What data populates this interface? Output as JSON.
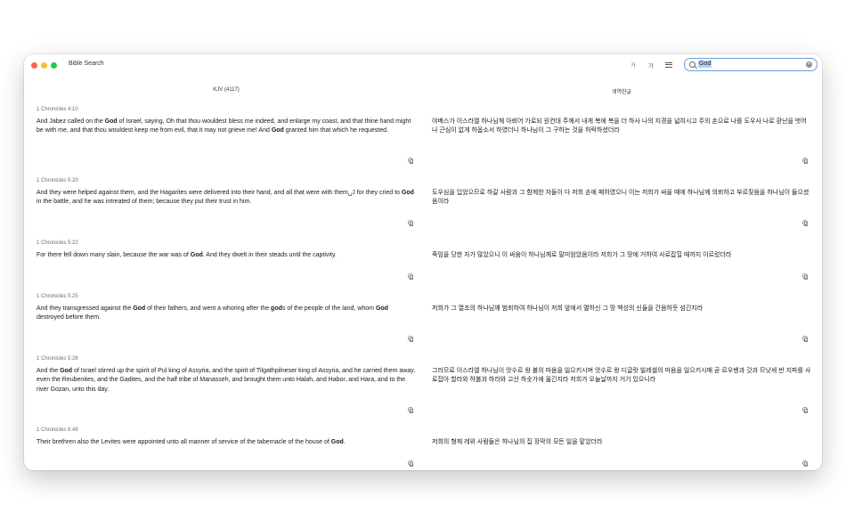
{
  "window": {
    "title": "Bible Search",
    "font_small_label": "가",
    "font_large_label": "가",
    "search": {
      "value": "God",
      "placeholder": ""
    }
  },
  "columns": {
    "left_header": "KJV (4117)",
    "right_header": "개역한글"
  },
  "verses": [
    {
      "ref": "1 Chronicles 4:10",
      "en": [
        "And Jabez called on the ",
        "God",
        " of Israel, saying, Oh that thou wouldest bless me indeed, and enlarge my coast, and that thine hand might be with me, and that thou wouldest keep me from evil, that it may not grieve me! And ",
        "God",
        " granted him that which he requested."
      ],
      "ko": "야베스가 이스라엘 하나님께 아뢰어 가로되 원컨대 주께서 내게 복에 복을 더 하사 나의 지경을 넓히시고 주의 손으로 나를 도우사 나로 환난을 벗어나 근심이 없게 하옵소서 하였더니 하나님이 그 구하는 것을 허락하셨더라"
    },
    {
      "ref": "1 Chronicles 5:20",
      "en": [
        "And they were helped against them, and the Hagarites were delivered into their hand, and all that were with them␣J for they cried to ",
        "God",
        " in the battle, and he was intreated of them; because they put their trust in him."
      ],
      "ko": "도우심을 입었으므로 하갈 사람과 그 함께한 자들이 다 저희 손에 패하였으니 이는 저희가 싸울 때에 하나님께 의뢰하고 부르짖음을 하나님이 들으셨음이라"
    },
    {
      "ref": "1 Chronicles 5:22",
      "en": [
        "For there fell down many slain, because the war was of ",
        "God",
        ". And they dwelt in their steads until the captivity."
      ],
      "ko": "죽임을 당한 자가 많았으니 이 싸움이 하나님께로 말미암았음이라 저희가 그 땅에 거하여 사로잡힐 때까지 이르렀더라"
    },
    {
      "ref": "1 Chronicles 5:25",
      "en": [
        "And they transgressed against the ",
        "God",
        " of their fathers, and went a whoring after the ",
        "god",
        "s of the people of the land, whom ",
        "God",
        " destroyed before them."
      ],
      "ko": "저희가 그 열조의 하나님께 범죄하여 하나님이 저희 앞에서 멸하신 그 땅 백성의 신들을 간음하듯 섬긴지라"
    },
    {
      "ref": "1 Chronicles 5:26",
      "en": [
        "And the ",
        "God",
        " of Israel stirred up the spirit of Pul king of Assyria, and the spirit of Tilgathpilneser king of Assyria, and he carried them away, even the Reubenites, and the Gadites, and the half tribe of Manasseh, and brought them unto Halah, and Habor, and Hara, and to the river Gozan, unto this day."
      ],
      "ko": "그러므로 이스라엘 하나님이 앗수르 왕 불의 마음을 일으키시며 앗수르 왕 디글랏 빌레셀의 마음을 일으키시매 곧 르우벤과 갓과 므낫세 반 지파를 사로잡아 할라와 하볼과 하라와 고산 하숫가에 옮긴지라 저희가 오늘날까지 거기 있으니라"
    },
    {
      "ref": "1 Chronicles 6:48",
      "en": [
        "Their brethren also the Levites were appointed unto all manner of service of the tabernacle of the house of ",
        "God",
        "."
      ],
      "ko": "저희의 형제 레위 사람들은 하나님의 집 장막의 모든 일을 맡았더라"
    }
  ]
}
